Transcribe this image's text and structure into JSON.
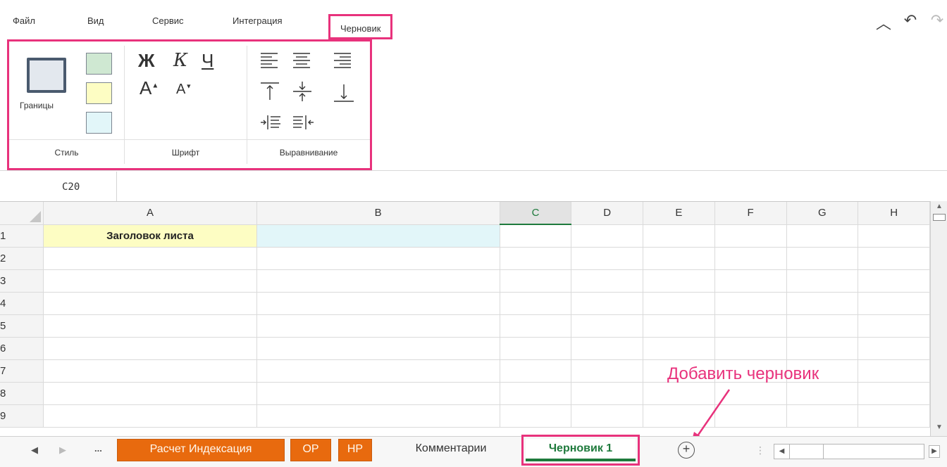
{
  "menu": {
    "file": "Файл",
    "view": "Вид",
    "service": "Сервис",
    "integration": "Интеграция",
    "draft": "Черновик"
  },
  "top_icons": [
    "chevron-up-icon",
    "undo-icon",
    "redo-icon"
  ],
  "ribbon": {
    "style_group": {
      "label": "Стиль",
      "borders_label": "Границы",
      "swatches": [
        "#cfe8d2",
        "#fdfdc3",
        "#e2f6f9"
      ]
    },
    "font_group": {
      "label": "Шрифт",
      "bold": "Ж",
      "italic": "К",
      "underline": "Ч",
      "grow": "A",
      "shrink": "A"
    },
    "align_group": {
      "label": "Выравнивание"
    }
  },
  "formula_bar": {
    "cell_ref": "C20",
    "value": ""
  },
  "grid": {
    "columns": [
      "A",
      "B",
      "C",
      "D",
      "E",
      "F",
      "G",
      "H"
    ],
    "active_column": "C",
    "rows": [
      "1",
      "2",
      "3",
      "4",
      "5",
      "6",
      "7",
      "8",
      "9"
    ],
    "cells": {
      "A1": "Заголовок листа"
    }
  },
  "annotation": "Добавить черновик",
  "tabs": {
    "ellipsis": "...",
    "sheets": [
      {
        "label": "Расчет Индексация",
        "style": "orange"
      },
      {
        "label": "ОР",
        "style": "orange"
      },
      {
        "label": "НР",
        "style": "orange"
      },
      {
        "label": "Комментарии",
        "style": "plain"
      },
      {
        "label": "Черновик 1",
        "style": "active"
      }
    ],
    "add_symbol": "+"
  },
  "colors": {
    "highlight": "#e8327c",
    "active_green": "#1e7a3c",
    "orange_tab": "#e86a0e"
  }
}
